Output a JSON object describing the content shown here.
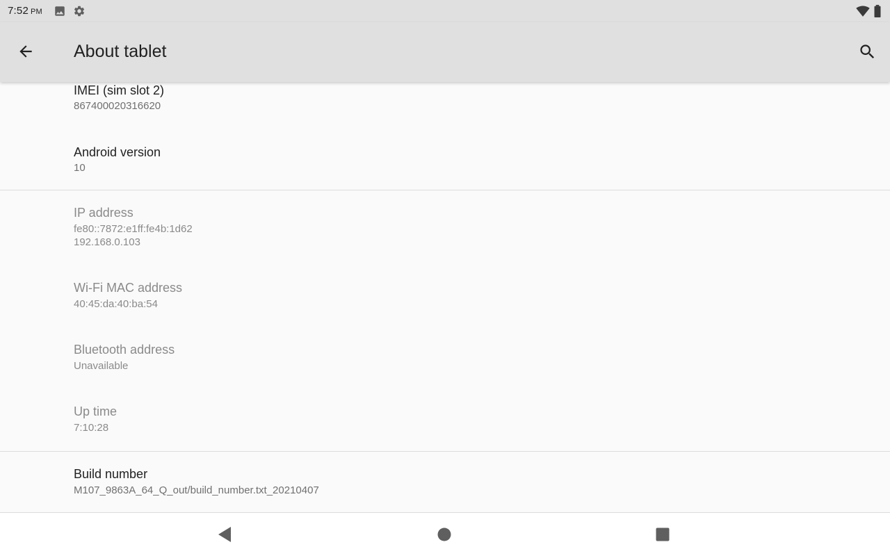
{
  "status_bar": {
    "time": "7:52",
    "ampm": "PM",
    "icons": [
      "image-icon",
      "gear-icon",
      "wifi-icon",
      "battery-icon"
    ]
  },
  "app_bar": {
    "title": "About tablet",
    "back_icon": "arrow-back-icon",
    "search_icon": "search-icon"
  },
  "items": [
    {
      "title": "IMEI (sim slot 2)",
      "summary": [
        "867400020316620"
      ],
      "enabled": true
    },
    {
      "title": "Android version",
      "summary": [
        "10"
      ],
      "enabled": true
    },
    {
      "title": "IP address",
      "summary": [
        "fe80::7872:e1ff:fe4b:1d62",
        "192.168.0.103"
      ],
      "enabled": false
    },
    {
      "title": "Wi-Fi MAC address",
      "summary": [
        "40:45:da:40:ba:54"
      ],
      "enabled": false
    },
    {
      "title": "Bluetooth address",
      "summary": [
        "Unavailable"
      ],
      "enabled": false
    },
    {
      "title": "Up time",
      "summary": [
        "7:10:28"
      ],
      "enabled": false
    },
    {
      "title": "Build number",
      "summary": [
        "M107_9863A_64_Q_out/build_number.txt_20210407"
      ],
      "enabled": true
    }
  ],
  "nav_bar": {
    "icons": [
      "nav-back-icon",
      "nav-home-icon",
      "nav-recents-icon"
    ]
  },
  "colors": {
    "status_bar_bg": "#e0e0e0",
    "content_bg": "#fafafa",
    "title_text": "#212121",
    "disabled_text": "#8a8a8a"
  }
}
